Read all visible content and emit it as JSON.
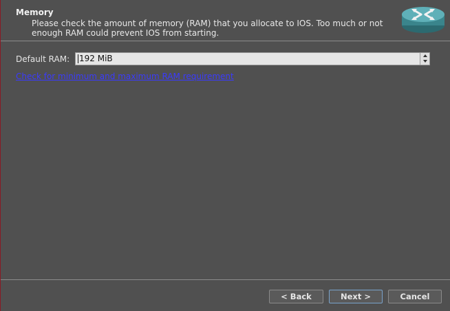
{
  "header": {
    "title": "Memory",
    "subtitle": "Please check the amount of memory (RAM) that you allocate to IOS. Too much or not enough RAM could prevent IOS from starting."
  },
  "icons": {
    "router": "router-icon",
    "spin_up": "chevron-up-icon",
    "spin_down": "chevron-down-icon"
  },
  "form": {
    "ram_label": "Default RAM:",
    "ram_value": "192 MiB"
  },
  "link": {
    "ram_requirement": "Check for minimum and maximum RAM requirement"
  },
  "buttons": {
    "back": "< Back",
    "next": "Next >",
    "cancel": "Cancel"
  },
  "colors": {
    "background": "#505050",
    "link": "#3a3aff",
    "router_icon": "#3f8e96"
  }
}
